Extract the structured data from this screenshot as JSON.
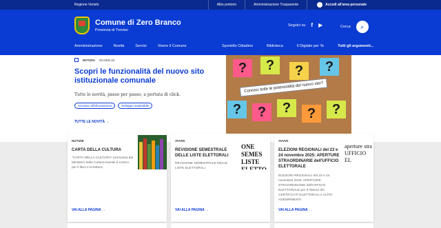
{
  "topbar": {
    "region": "Regione Veneto",
    "links": [
      "Albo pretorio",
      "Amministrazione Trasparente"
    ],
    "login": "Accedi all'area personale"
  },
  "header": {
    "title": "Comune di Zero Branco",
    "subtitle": "Provincia di Treviso",
    "follow": "Seguici su",
    "search": "Cerca"
  },
  "nav": {
    "left": [
      "Amministrazione",
      "Novità",
      "Servizi",
      "Vivere il Comune"
    ],
    "right": [
      "Sportello Cittadino",
      "Biblioteca",
      "Il Digitale per Te",
      "Tutti gli argomenti..."
    ]
  },
  "hero": {
    "category": "NOTIZIA",
    "date": "03 GEN 24",
    "title": "Scopri le funzionalità del nuovo sito istituzionale comunale",
    "desc": "Tutte le novità, passo per passo, a portata di click.",
    "chips": [
      "Accesso all'informazione",
      "Sviluppo sostenibile"
    ],
    "link": "TUTTE LE NOVITÀ",
    "banner": "Conosci tutte le potenzialità del nuovo sito?"
  },
  "cards": [
    {
      "category": "NOTIZIE",
      "title": "CARTA DELLA CULTURA",
      "desc": "\"CARTA DELLA CULTURA\" promossa dal Ministero della Cultura tramite il Centro per il libro e la lettura.",
      "link": "VAI ALLA PAGINA"
    },
    {
      "category": "AVVISI",
      "title": "REVISIONE SEMESTRALE DELLE LISTE ELETTORALI",
      "desc": "REVISIONE SEMESTRALE DELLE LISTE ELETTORALI",
      "link": "VAI ALLA PAGINA",
      "thumb": "ONE SEMES LISTE ELETTO"
    },
    {
      "category": "AVVISI",
      "title": "ELEZIONI REGIONALI del 23 e 24 novembre 2025: APERTURE STRAORDINARIE dell'UFFICIO ELETTORALE",
      "desc": "ELEZIONI REGIONALI del 23 e 24 novembre 2025: APERTURE STRAORDINARIE dell'UFFICIO ELETTORALE per il rilascio dei CERTIFICATI ELETTORALI e ALTRI ADEMPIMENTI",
      "link": "VAI ALLA PAGINA",
      "thumb": "aperture stra UFFICIO EL"
    }
  ]
}
